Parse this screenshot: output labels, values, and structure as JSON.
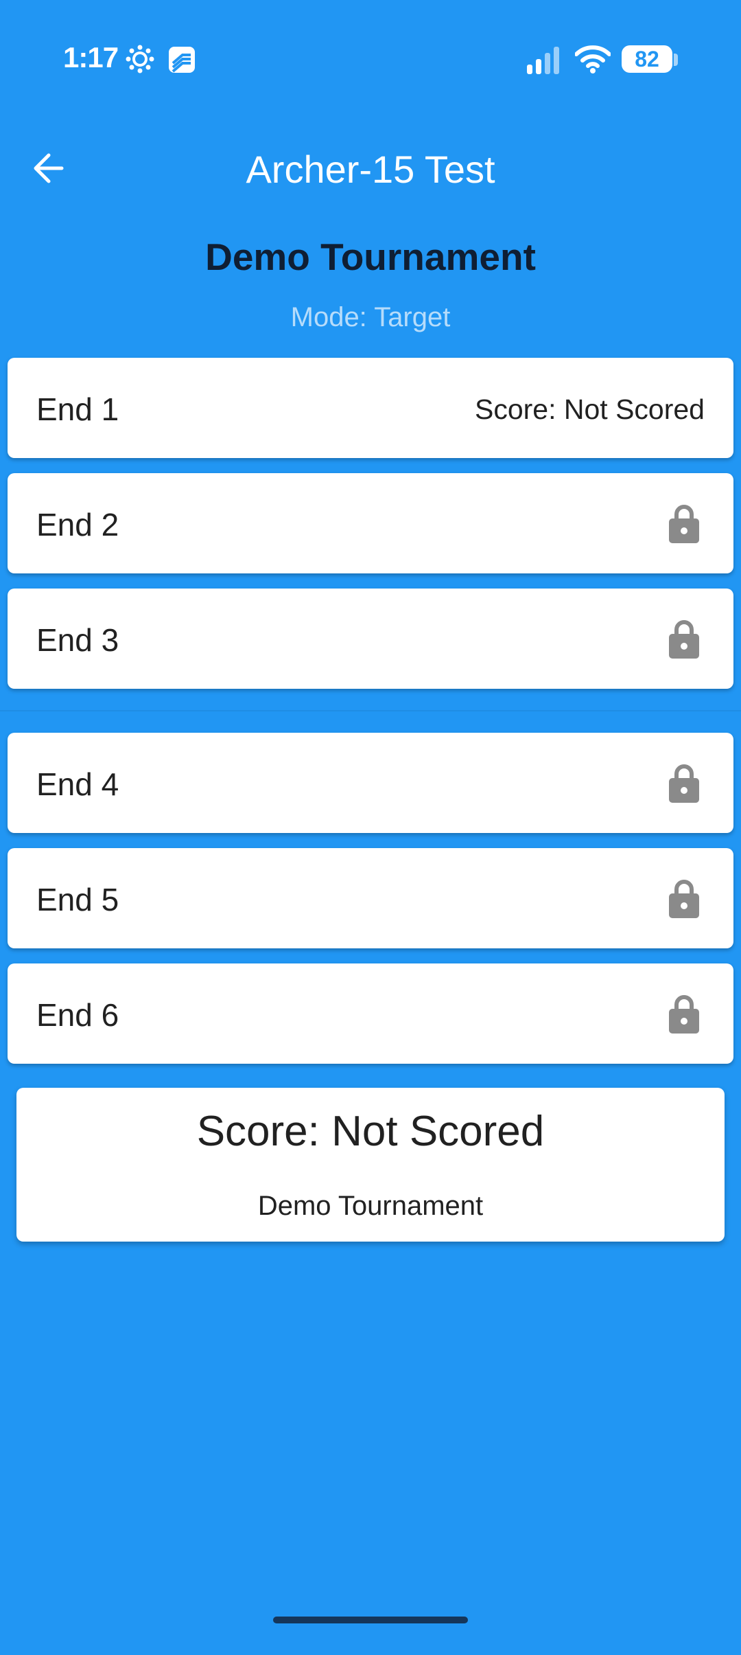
{
  "status_bar": {
    "time": "1:17",
    "battery": "82",
    "icons": [
      "brightness-icon",
      "app-notification-icon",
      "signal-icon",
      "wifi-icon",
      "battery-icon"
    ]
  },
  "app_bar": {
    "title": "Archer-15 Test",
    "back_icon": "arrow-back-icon"
  },
  "header": {
    "tournament": "Demo Tournament",
    "mode": "Mode: Target"
  },
  "ends": [
    {
      "label": "End 1",
      "score": "Score: Not Scored",
      "locked": false
    },
    {
      "label": "End 2",
      "locked": true
    },
    {
      "label": "End 3",
      "locked": true
    },
    {
      "label": "End 4",
      "locked": true
    },
    {
      "label": "End 5",
      "locked": true
    },
    {
      "label": "End 6",
      "locked": true
    }
  ],
  "summary": {
    "score": "Score: Not Scored",
    "tournament": "Demo Tournament"
  },
  "colors": {
    "background": "#2196F3",
    "card": "#ffffff",
    "lock": "#8a8a8a",
    "title_dark": "#0f1e33"
  }
}
